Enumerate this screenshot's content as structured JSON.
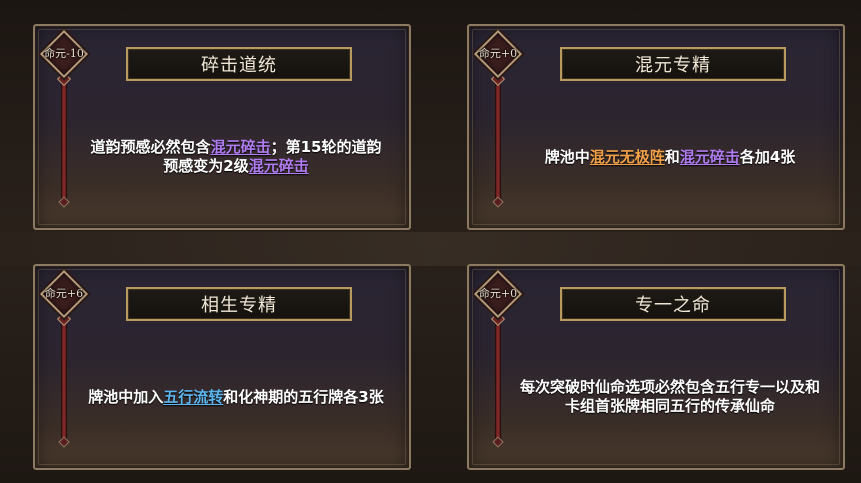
{
  "colors": {
    "purple_highlight": "#b07cf2",
    "orange_highlight": "#f3a24a",
    "blue_highlight": "#5cb6f0",
    "gold_border": "#b89a5e"
  },
  "cards": [
    {
      "badge": "命元-10",
      "title": "碎击道统",
      "desc": {
        "t1": "道韵预感必然包含",
        "h1": "混元碎击",
        "t2": "；第15轮的道韵预感变为2级",
        "h2": "混元碎击",
        "t3": ""
      }
    },
    {
      "badge": "命元+0",
      "title": "混元专精",
      "desc": {
        "t1": "牌池中",
        "h1": "混元无极阵",
        "t2": "和",
        "h2": "混元碎击",
        "t3": "各加4张"
      }
    },
    {
      "badge": "命元+6",
      "title": "相生专精",
      "desc": {
        "t1": "牌池中加入",
        "h1": "五行流转",
        "t2": "和化神期的五行牌各3张"
      }
    },
    {
      "badge": "命元+0",
      "title": "专一之命",
      "desc": {
        "t1": "每次突破时仙命选项必然包含五行专一以及和卡组首张牌相同五行的传承仙命"
      }
    }
  ]
}
